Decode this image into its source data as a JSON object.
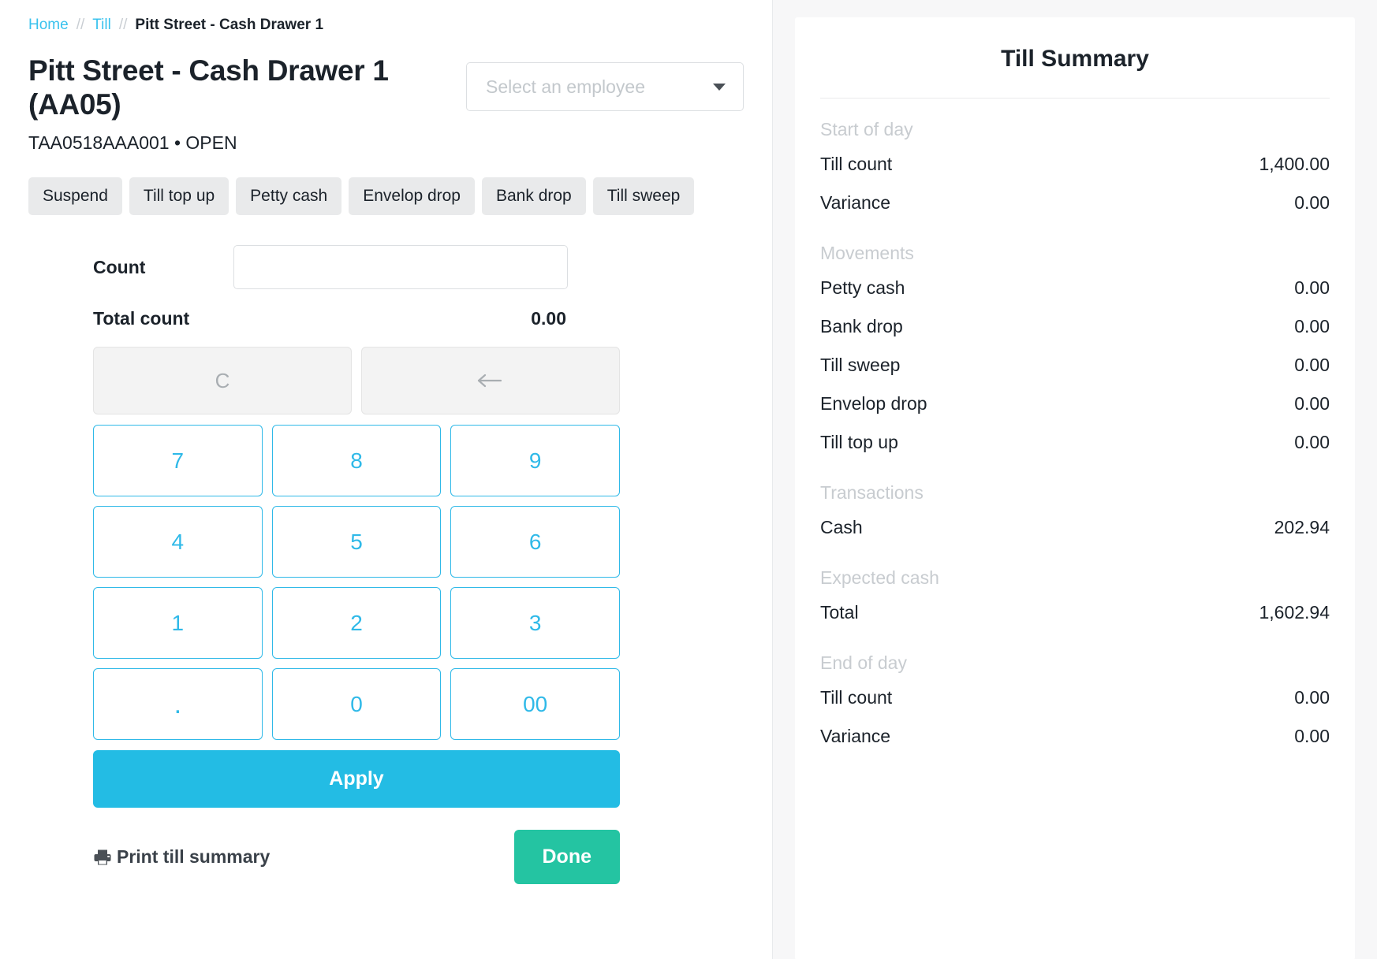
{
  "breadcrumb": {
    "home": "Home",
    "till": "Till",
    "separator": "//",
    "current": "Pitt Street - Cash Drawer 1"
  },
  "header": {
    "title": "Pitt Street - Cash Drawer 1 (AA05)",
    "subtitle": "TAA0518AAA001 • OPEN",
    "employee_select_placeholder": "Select an employee"
  },
  "actions": [
    {
      "label": "Suspend"
    },
    {
      "label": "Till top up"
    },
    {
      "label": "Petty cash"
    },
    {
      "label": "Envelop drop"
    },
    {
      "label": "Bank drop"
    },
    {
      "label": "Till sweep"
    }
  ],
  "count_form": {
    "count_label": "Count",
    "count_value": "",
    "count_placeholder": "",
    "total_label": "Total count",
    "total_value": "0.00"
  },
  "keypad": {
    "clear_label": "C",
    "backspace_label": "←",
    "keys": [
      "7",
      "8",
      "9",
      "4",
      "5",
      "6",
      "1",
      "2",
      "3",
      ".",
      "0",
      "00"
    ],
    "apply_label": "Apply"
  },
  "footer": {
    "print_label": "Print till summary",
    "done_label": "Done"
  },
  "summary": {
    "title": "Till Summary",
    "sections": [
      {
        "heading": "Start of day",
        "rows": [
          {
            "label": "Till count",
            "value": "1,400.00"
          },
          {
            "label": "Variance",
            "value": "0.00"
          }
        ]
      },
      {
        "heading": "Movements",
        "rows": [
          {
            "label": "Petty cash",
            "value": "0.00"
          },
          {
            "label": "Bank drop",
            "value": "0.00"
          },
          {
            "label": "Till sweep",
            "value": "0.00"
          },
          {
            "label": "Envelop drop",
            "value": "0.00"
          },
          {
            "label": "Till top up",
            "value": "0.00"
          }
        ]
      },
      {
        "heading": "Transactions",
        "rows": [
          {
            "label": "Cash",
            "value": "202.94"
          }
        ]
      },
      {
        "heading": "Expected cash",
        "rows": [
          {
            "label": "Total",
            "value": "1,602.94"
          }
        ]
      },
      {
        "heading": "End of day",
        "rows": [
          {
            "label": "Till count",
            "value": "0.00"
          },
          {
            "label": "Variance",
            "value": "0.00"
          }
        ]
      }
    ]
  },
  "colors": {
    "accent_cyan": "#23bce4",
    "link_cyan": "#39c2ee",
    "done_green": "#24c4a2",
    "muted_gray": "#c8ccd0"
  }
}
